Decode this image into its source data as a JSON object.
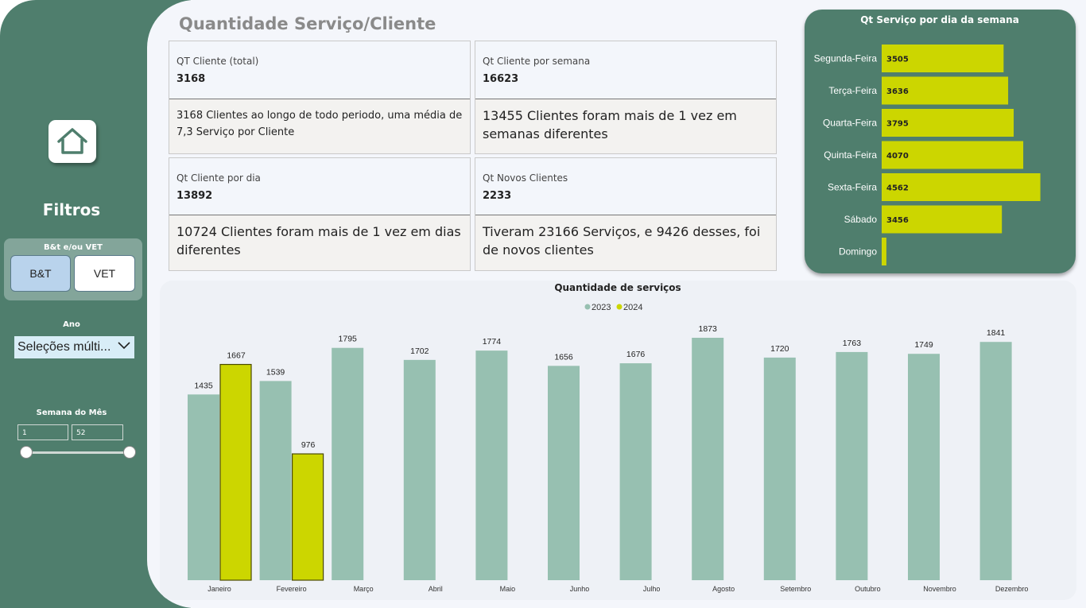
{
  "sidebar": {
    "home_icon": "home-icon",
    "filters_title": "Filtros",
    "segment_slicer": {
      "title": "B&t e/ou VET",
      "options": [
        "B&T",
        "VET"
      ],
      "selected": "B&T"
    },
    "year_slicer": {
      "title": "Ano",
      "value": "Seleções múlti..."
    },
    "week_slicer": {
      "title": "Semana do Mês",
      "min": "1",
      "max": "52"
    }
  },
  "header": {
    "title": "Quantidade Serviço/Cliente"
  },
  "cards": [
    {
      "label": "QT Cliente (total)",
      "value": "3168",
      "description": "3168 Clientes ao longo de todo periodo, uma média de 7,3 Serviço por Cliente"
    },
    {
      "label": "Qt Cliente por semana",
      "value": "16623",
      "description": "13455 Clientes foram mais de 1 vez em semanas diferentes"
    },
    {
      "label": "Qt Cliente por dia",
      "value": "13892",
      "description": "10724 Clientes foram mais de 1 vez em dias diferentes"
    },
    {
      "label": "Qt Novos Clientes",
      "value": "2233",
      "description": "Tiveram 23166 Serviços, e 9426 desses, foi de novos clientes"
    }
  ],
  "colors": {
    "sidebar": "#4f7e6d",
    "bar_2023": "#97c0b1",
    "bar_2024": "#ccd600",
    "bar_2024_border": "#4a4a00"
  },
  "chart_data": [
    {
      "type": "bar",
      "orientation": "horizontal",
      "title": "Qt Serviço por dia da semana",
      "categories": [
        "Segunda-Feira",
        "Terça-Feira",
        "Quarta-Feira",
        "Quinta-Feira",
        "Sexta-Feira",
        "Sábado",
        "Domingo"
      ],
      "values": [
        3505,
        3636,
        3795,
        4070,
        4562,
        3456,
        135
      ],
      "labels": [
        "3505",
        "3636",
        "3795",
        "4070",
        "4562",
        "3456",
        ""
      ],
      "xlim": [
        0,
        4800
      ]
    },
    {
      "type": "bar",
      "title": "Quantidade de serviços",
      "categories": [
        "Janeiro",
        "Fevereiro",
        "Março",
        "Abril",
        "Maio",
        "Junho",
        "Julho",
        "Agosto",
        "Setembro",
        "Outubro",
        "Novembro",
        "Dezembro"
      ],
      "series": [
        {
          "name": "2023",
          "values": [
            1435,
            1539,
            1795,
            1702,
            1774,
            1656,
            1676,
            1873,
            1720,
            1763,
            1749,
            1841
          ]
        },
        {
          "name": "2024",
          "values": [
            1667,
            976,
            null,
            null,
            null,
            null,
            null,
            null,
            null,
            null,
            null,
            null
          ]
        }
      ],
      "legend": "top-center",
      "ylim": [
        0,
        1873
      ]
    }
  ]
}
